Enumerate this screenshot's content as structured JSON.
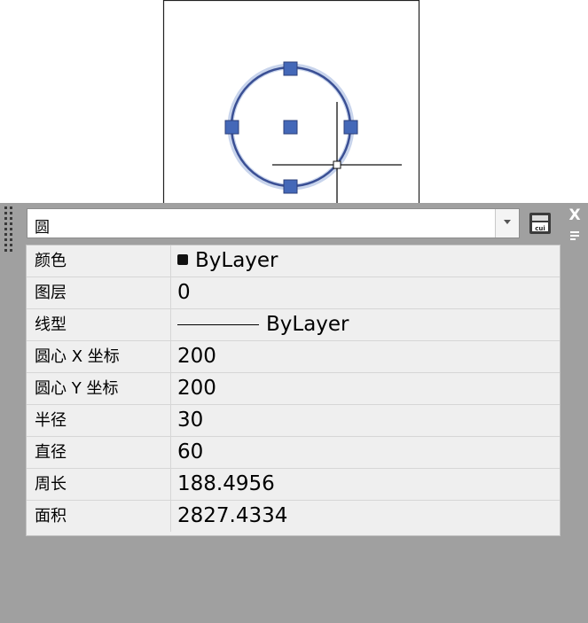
{
  "drawing": {
    "object": "circle",
    "accent_color": "#3a4f94",
    "grip_color": "#4468b8"
  },
  "palette": {
    "selector": {
      "value": "圆"
    },
    "icons": {
      "cui": "cui-icon",
      "close": "close-icon",
      "menu": "menu-icon",
      "dropdown": "chevron-down-icon"
    },
    "close_glyph": "X",
    "rows": [
      {
        "label": "颜色",
        "value": "ByLayer",
        "kind": "color",
        "swatch": "#111111"
      },
      {
        "label": "图层",
        "value": "0"
      },
      {
        "label": "线型",
        "value": "ByLayer",
        "kind": "linetype"
      },
      {
        "label": "圆心 X 坐标",
        "value": "200"
      },
      {
        "label": "圆心 Y 坐标",
        "value": "200"
      },
      {
        "label": "半径",
        "value": "30"
      },
      {
        "label": "直径",
        "value": "60"
      },
      {
        "label": "周长",
        "value": "188.4956"
      },
      {
        "label": "面积",
        "value": "2827.4334"
      }
    ]
  }
}
